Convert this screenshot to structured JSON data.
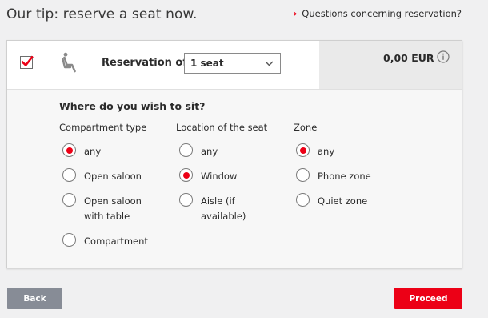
{
  "header": {
    "title": "Our tip: reserve a seat now.",
    "questions_link": "Questions concerning reservation?"
  },
  "reservation": {
    "checked": true,
    "label": "Reservation of",
    "seat_select_value": "1 seat",
    "price": "0,00 EUR"
  },
  "preferences": {
    "title": "Where do you wish to sit?",
    "compartment": {
      "heading": "Compartment type",
      "options": [
        "any",
        "Open saloon",
        "Open saloon with table",
        "Compartment"
      ],
      "selected": "any"
    },
    "location": {
      "heading": "Location of the seat",
      "options": [
        "any",
        "Window",
        "Aisle (if available)"
      ],
      "selected": "Window"
    },
    "zone": {
      "heading": "Zone",
      "options": [
        "any",
        "Phone zone",
        "Quiet zone"
      ],
      "selected": "any"
    }
  },
  "footer": {
    "back_label": "Back",
    "proceed_label": "Proceed"
  },
  "colors": {
    "accent": "#ec0016",
    "back_button": "#878c96"
  },
  "icons": [
    "chevron-right-icon",
    "checkmark-icon",
    "seat-icon",
    "chevron-down-icon",
    "info-icon"
  ]
}
